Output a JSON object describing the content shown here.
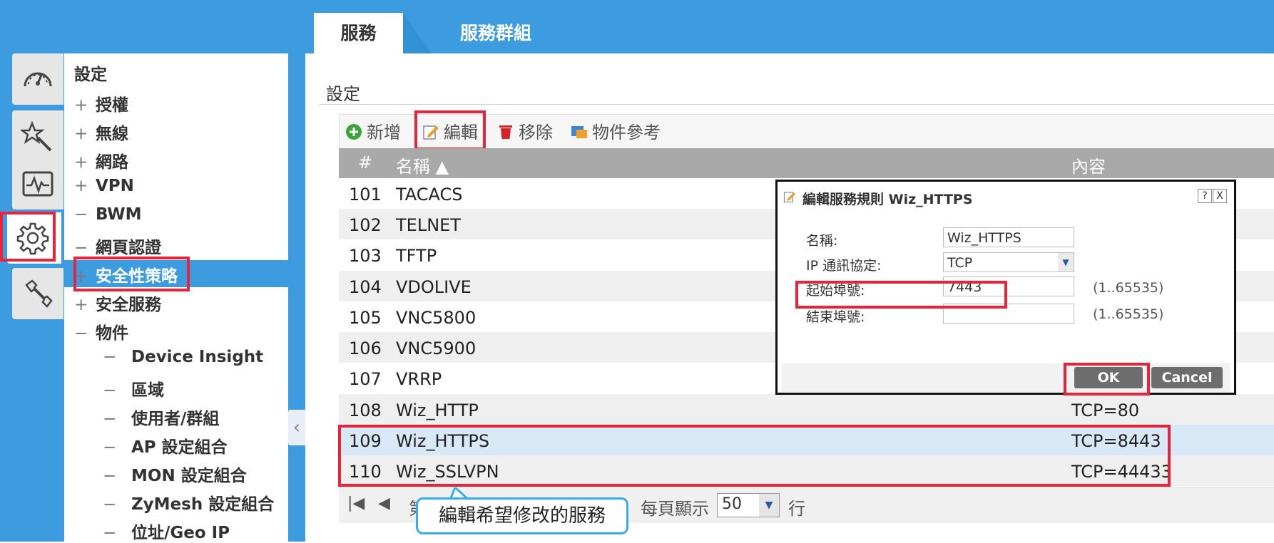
{
  "tabs": [
    {
      "label": "服務"
    },
    {
      "label": "服務群組"
    }
  ],
  "sidebar_icons": [
    "dashboard-icon",
    "wizard-icon",
    "monitor-icon",
    "gear-icon",
    "tools-icon"
  ],
  "menu": {
    "title": "設定",
    "items": [
      {
        "prefix": "+",
        "label": "授權"
      },
      {
        "prefix": "+",
        "label": "無線"
      },
      {
        "prefix": "+",
        "label": "網路"
      },
      {
        "prefix": "+",
        "label": "VPN"
      },
      {
        "prefix": "−",
        "label": "BWM"
      },
      {
        "prefix": "−",
        "label": "網頁認證"
      },
      {
        "prefix": "+",
        "label": "安全性策略"
      },
      {
        "prefix": "+",
        "label": "安全服務"
      },
      {
        "prefix": "−",
        "label": "物件"
      }
    ],
    "subitems": [
      {
        "prefix": "−",
        "label": "Device Insight"
      },
      {
        "prefix": "−",
        "label": "區域"
      },
      {
        "prefix": "−",
        "label": "使用者/群組"
      },
      {
        "prefix": "−",
        "label": "AP 設定組合"
      },
      {
        "prefix": "−",
        "label": "MON 設定組合"
      },
      {
        "prefix": "−",
        "label": "ZyMesh 設定組合"
      },
      {
        "prefix": "−",
        "label": "位址/Geo IP"
      }
    ]
  },
  "main": {
    "section_label": "設定",
    "toolbar": {
      "add": "新增",
      "edit": "編輯",
      "remove": "移除",
      "reference": "物件參考"
    },
    "columns": {
      "num": "#",
      "name": "名稱 ▲",
      "content": "內容"
    },
    "rows": [
      {
        "num": "101",
        "name": "TACACS",
        "content": ""
      },
      {
        "num": "102",
        "name": "TELNET",
        "content": ""
      },
      {
        "num": "103",
        "name": "TFTP",
        "content": ""
      },
      {
        "num": "104",
        "name": "VDOLIVE",
        "content": ""
      },
      {
        "num": "105",
        "name": "VNC5800",
        "content": ""
      },
      {
        "num": "106",
        "name": "VNC5900",
        "content": ""
      },
      {
        "num": "107",
        "name": "VRRP",
        "content": ""
      },
      {
        "num": "108",
        "name": "Wiz_HTTP",
        "content": "TCP=80"
      },
      {
        "num": "109",
        "name": "Wiz_HTTPS",
        "content": "TCP=8443"
      },
      {
        "num": "110",
        "name": "Wiz_SSLVPN",
        "content": "TCP=44433"
      }
    ],
    "pager": {
      "page_prefix": "第",
      "per_page_label": "每頁顯示",
      "per_page_value": "50",
      "per_page_suffix": "行"
    }
  },
  "dialog": {
    "title": "編輯服務規則 Wiz_HTTPS",
    "help": "?",
    "close": "X",
    "fields": {
      "name_label": "名稱:",
      "name_value": "Wiz_HTTPS",
      "protocol_label": "IP 通訊協定:",
      "protocol_value": "TCP",
      "start_label": "起始埠號:",
      "start_value": "7443",
      "start_hint": "(1..65535)",
      "end_label": "結束埠號:",
      "end_value": "",
      "end_hint": "(1..65535)"
    },
    "ok": "OK",
    "cancel": "Cancel"
  },
  "callout": "編輯希望修改的服務",
  "colors": {
    "accent": "#3d9be0",
    "highlight": "#e8243c",
    "callout_border": "#35aee8"
  }
}
